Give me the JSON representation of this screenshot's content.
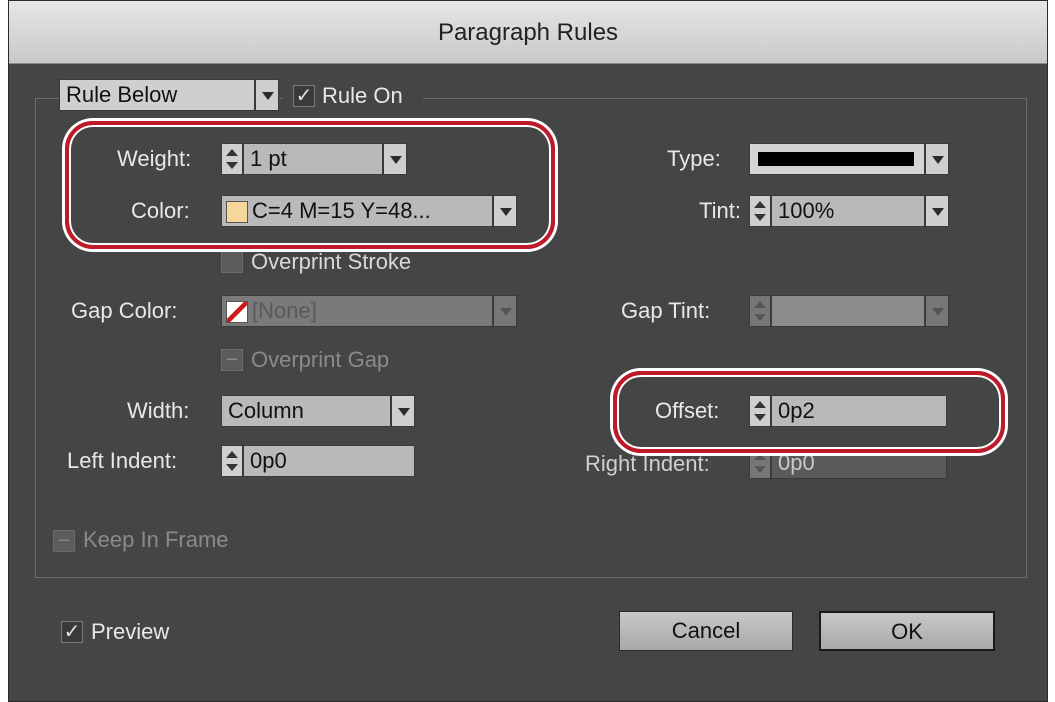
{
  "dialog": {
    "title": "Paragraph Rules"
  },
  "rule_type": {
    "value": "Rule Below"
  },
  "rule_on": {
    "label": "Rule On",
    "checked": true,
    "check_glyph": "✓"
  },
  "weight": {
    "label": "Weight:",
    "value": "1 pt"
  },
  "color": {
    "label": "Color:",
    "value": "C=4 M=15 Y=48...",
    "swatch_color": "#f5d79a"
  },
  "type": {
    "label": "Type:",
    "swatch_color": "#000000"
  },
  "tint": {
    "label": "Tint:",
    "value": "100%"
  },
  "overprint_stroke": {
    "label": "Overprint Stroke"
  },
  "gap_color": {
    "label": "Gap Color:",
    "value": "[None]"
  },
  "gap_tint": {
    "label": "Gap Tint:",
    "value": ""
  },
  "overprint_gap": {
    "label": "Overprint Gap",
    "glyph": "−"
  },
  "width": {
    "label": "Width:",
    "value": "Column"
  },
  "offset": {
    "label": "Offset:",
    "value": "0p2"
  },
  "left_indent": {
    "label": "Left Indent:",
    "value": "0p0"
  },
  "right_indent": {
    "label": "Right Indent:",
    "value": "0p0"
  },
  "keep_in_frame": {
    "label": "Keep In Frame",
    "glyph": "−"
  },
  "preview": {
    "label": "Preview",
    "checked": true,
    "check_glyph": "✓"
  },
  "buttons": {
    "cancel": "Cancel",
    "ok": "OK"
  },
  "colors": {
    "highlight": "#c01a2a",
    "dialog_bg": "#454545"
  }
}
